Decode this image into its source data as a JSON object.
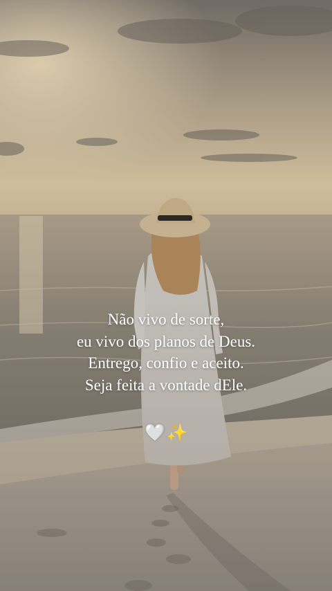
{
  "caption": {
    "lines": [
      "Não vivo de sorte,",
      "eu vivo dos planos de Deus.",
      "Entrego, confio e aceito.",
      "Seja feita a vontade dEle."
    ]
  },
  "emojis": {
    "heart": "🤍",
    "sparkles": "✨"
  },
  "colors": {
    "sky_top": "#7d7770",
    "sky_glow": "#e8d2a8",
    "sea": "#8c8478",
    "sand": "#a89e94",
    "text": "#ffffff"
  },
  "icons": [
    "white-heart-icon",
    "sparkles-icon"
  ]
}
